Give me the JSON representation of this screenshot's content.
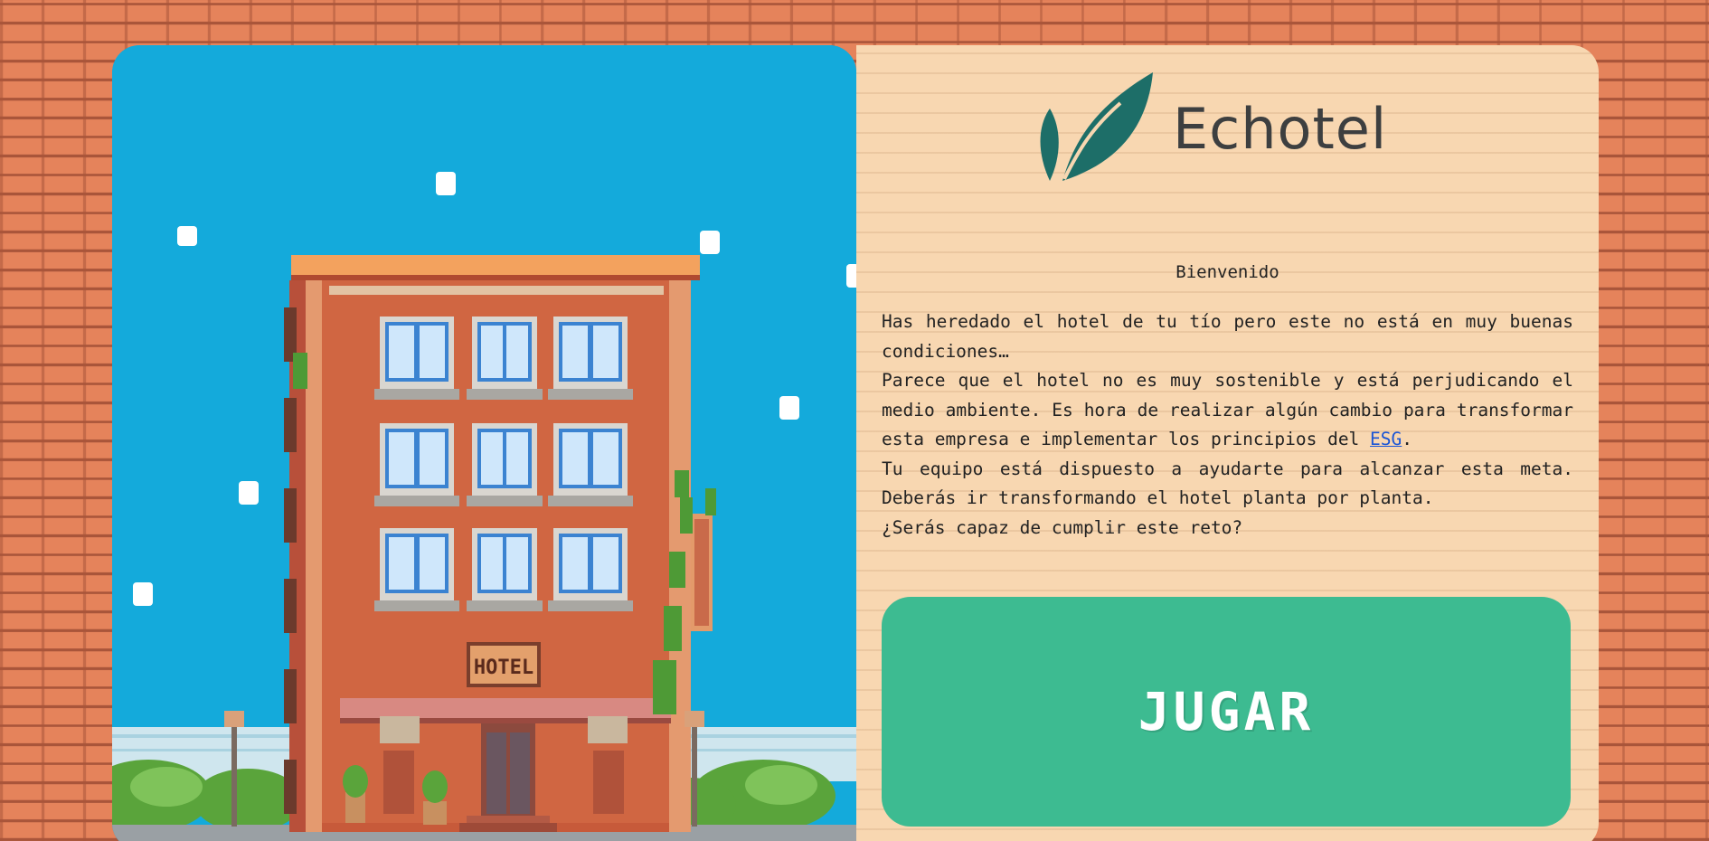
{
  "brand": {
    "name": "Echotel",
    "logo_icon": "leaf-icon",
    "logo_color": "#1d6e68"
  },
  "welcome": {
    "title": "Bienvenido",
    "line1": "Has heredado el hotel de tu tío pero este no está en muy buenas condiciones…",
    "line2_before": "Parece que el hotel no es muy sostenible y está perjudicando el medio ambiente. Es hora de realizar algún cambio para transformar esta empresa e implementar los principios del ",
    "line2_link": "ESG",
    "line2_after": ".",
    "line3": "Tu equipo está dispuesto a ayudarte para alcanzar esta meta. Deberás ir transformando el hotel planta por planta.",
    "line4": "¿Serás capaz de cumplir este reto?"
  },
  "illustration": {
    "sign_text": "HOTEL",
    "sky_color": "#14aadb",
    "building_color": "#c75a3a"
  },
  "play_button": {
    "label": "JUGAR",
    "color": "#3dbb91"
  },
  "colors": {
    "wall_brick": "#e5835b",
    "panel_background": "#f8d7b1",
    "link": "#1a55d6"
  }
}
